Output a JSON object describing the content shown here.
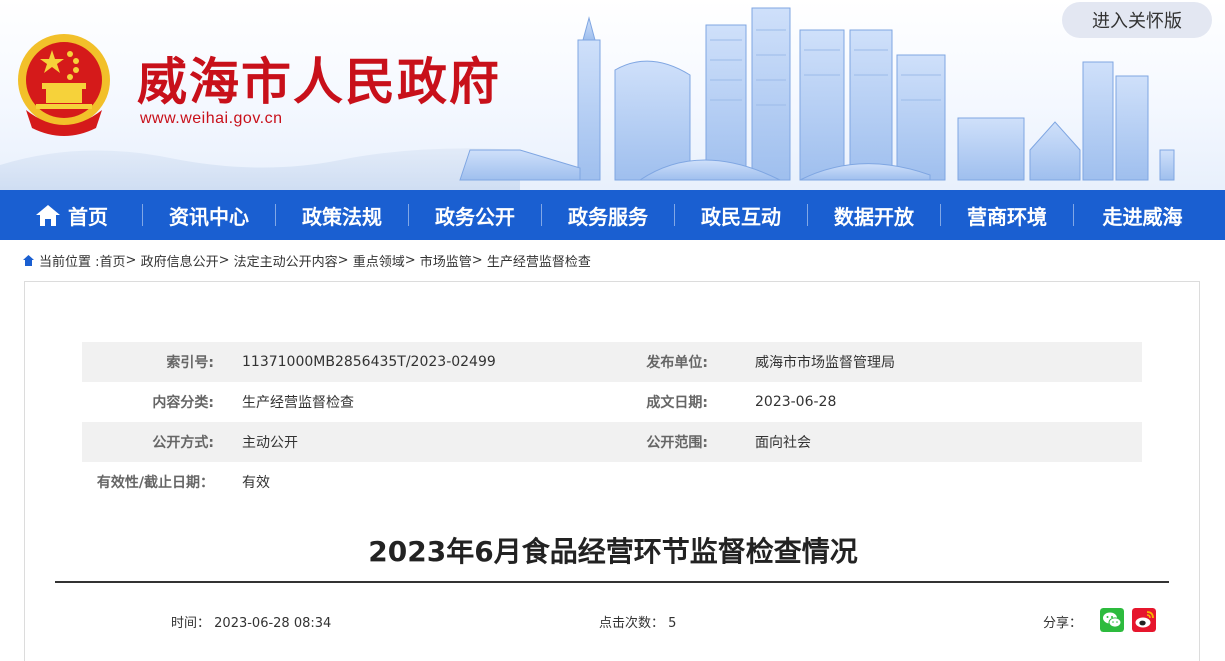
{
  "header": {
    "site_title": "威海市人民政府",
    "site_url": "www.weihai.gov.cn",
    "care_button": "进入关怀版",
    "colors": {
      "title_red": "#c8101a",
      "nav_blue": "#1a5fd1"
    }
  },
  "nav": {
    "items": [
      {
        "label": "首页",
        "icon": "home-icon"
      },
      {
        "label": "资讯中心"
      },
      {
        "label": "政策法规"
      },
      {
        "label": "政务公开"
      },
      {
        "label": "政务服务"
      },
      {
        "label": "政民互动"
      },
      {
        "label": "数据开放"
      },
      {
        "label": "营商环境"
      },
      {
        "label": "走进威海"
      }
    ]
  },
  "breadcrumb": {
    "prefix": "当前位置 :",
    "items": [
      "首页",
      "政府信息公开",
      "法定主动公开内容",
      "重点领域",
      "市场监管",
      "生产经营监督检查"
    ],
    "separator": ">"
  },
  "meta": {
    "index_label": "索引号:",
    "index_value": "11371000MB2856435T/2023-02499",
    "publisher_label": "发布单位:",
    "publisher_value": "威海市市场监督管理局",
    "category_label": "内容分类:",
    "category_value": "生产经营监督检查",
    "date_label": "成文日期:",
    "date_value": "2023-06-28",
    "method_label": "公开方式:",
    "method_value": "主动公开",
    "scope_label": "公开范围:",
    "scope_value": "面向社会",
    "validity_label": "有效性/截止日期：",
    "validity_value": "有效"
  },
  "article": {
    "title": "2023年6月食品经营环节监督检查情况",
    "time_label": "时间：",
    "time_value": "2023-06-28 08:34",
    "clicks_label": "点击次数：",
    "clicks_value": "5",
    "share_label": "分享：",
    "share_icons": [
      "wechat-icon",
      "weibo-icon"
    ]
  }
}
